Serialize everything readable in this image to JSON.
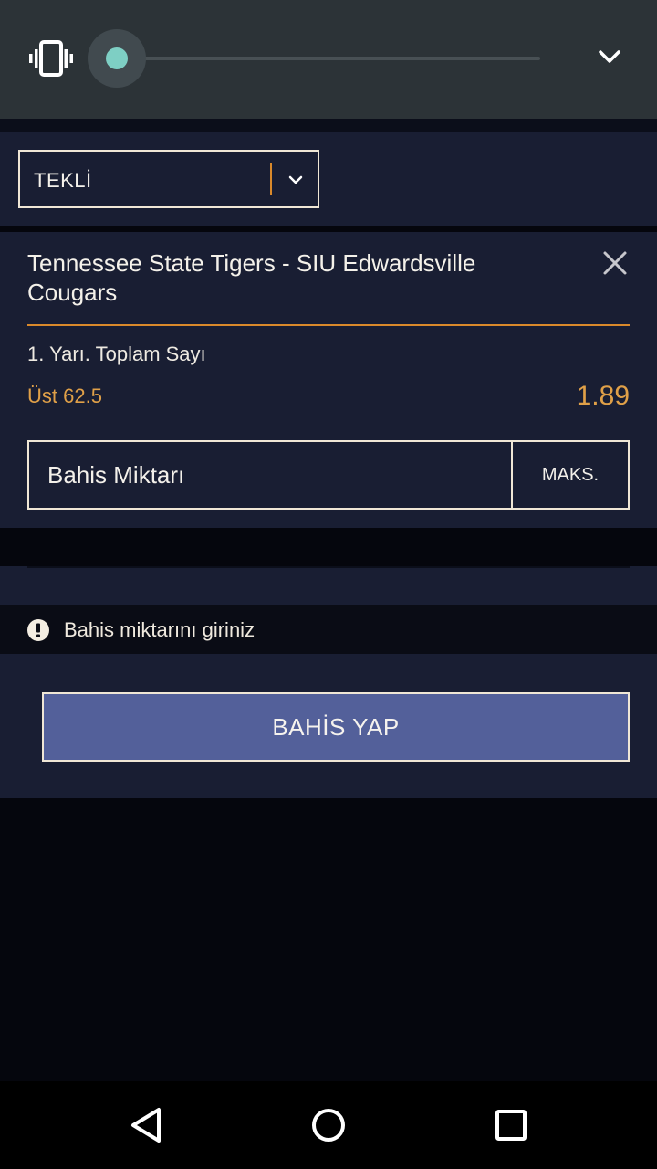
{
  "volume_panel": {
    "vibrate_icon": "vibrate-icon",
    "collapse_icon": "chevron-down-icon",
    "volume_level": 0.0
  },
  "bet_type": {
    "selected": "TEKLİ",
    "chevron_icon": "chevron-down-icon"
  },
  "slip": {
    "match": "Tennessee State Tigers - SIU Edwardsville Cougars",
    "market": "1. Yarı. Toplam Sayı",
    "selection": "Üst 62.5",
    "odds": "1.89",
    "stake_placeholder": "Bahis Miktarı",
    "max_label": "MAKS.",
    "remove_icon": "close-icon"
  },
  "warning": {
    "icon": "alert-circle-icon",
    "text": "Bahis miktarını giriniz"
  },
  "action": {
    "place_bet_label": "BAHİS YAP"
  },
  "nav": {
    "back_icon": "back-triangle-icon",
    "home_icon": "home-circle-icon",
    "recents_icon": "recents-square-icon"
  },
  "colors": {
    "accent": "#d9892b",
    "odds": "#e0a048",
    "panel_bg": "#191e33",
    "button_bg": "#53609a",
    "slider_thumb": "#7ecfc4"
  }
}
